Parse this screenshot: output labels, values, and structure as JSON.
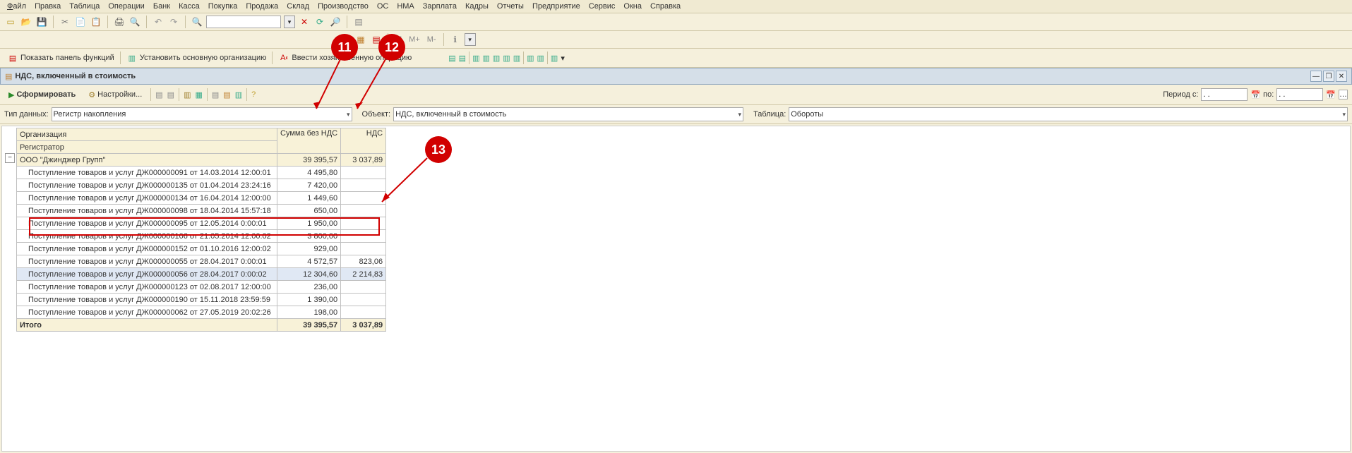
{
  "menu": {
    "file": "Файл",
    "edit": "Правка",
    "table": "Таблица",
    "ops": "Операции",
    "bank": "Банк",
    "cash": "Касса",
    "buy": "Покупка",
    "sell": "Продажа",
    "stock": "Склад",
    "prod": "Производство",
    "os": "ОС",
    "nma": "НМА",
    "salary": "Зарплата",
    "hr": "Кадры",
    "reports": "Отчеты",
    "company": "Предприятие",
    "service": "Сервис",
    "windows": "Окна",
    "help": "Справка"
  },
  "action_bar": {
    "panel": "Показать панель функций",
    "org": "Установить основную организацию",
    "hoz": "Ввести хозяйственную операцию"
  },
  "tab_title": "НДС, включенный в стоимость",
  "report_toolbar": {
    "form": "Сформировать",
    "settings": "Настройки...",
    "period_label": "Период с:",
    "period_to": "по:",
    "period_from_val": ". .",
    "period_to_val": ". ."
  },
  "filters": {
    "type_label": "Тип данных:",
    "type_value": "Регистр накопления",
    "obj_label": "Объект:",
    "obj_value": "НДС, включенный в стоимость",
    "tab_label": "Таблица:",
    "tab_value": "Обороты"
  },
  "headers": {
    "org": "Организация",
    "reg": "Регистратор",
    "sum": "Сумма без НДС",
    "nds": "НДС"
  },
  "group_row": {
    "name": "ООО \"Джинджер Групп\"",
    "sum": "39 395,57",
    "nds": "3 037,89"
  },
  "rows": [
    {
      "reg": "Поступление товаров и услуг ДЖ000000091 от 14.03.2014 12:00:01",
      "sum": "4 495,80",
      "nds": ""
    },
    {
      "reg": "Поступление товаров и услуг ДЖ000000135 от 01.04.2014 23:24:16",
      "sum": "7 420,00",
      "nds": ""
    },
    {
      "reg": "Поступление товаров и услуг ДЖ000000134 от 16.04.2014 12:00:00",
      "sum": "1 449,60",
      "nds": ""
    },
    {
      "reg": "Поступление товаров и услуг ДЖ000000098 от 18.04.2014 15:57:18",
      "sum": "650,00",
      "nds": ""
    },
    {
      "reg": "Поступление товаров и услуг ДЖ000000095 от 12.05.2014 0:00:01",
      "sum": "1 950,00",
      "nds": ""
    },
    {
      "reg": "Поступление товаров и услуг ДЖ000000106 от 21.05.2014 12:00:02",
      "sum": "3 800,00",
      "nds": ""
    },
    {
      "reg": "Поступление товаров и услуг ДЖ000000152 от 01.10.2016 12:00:02",
      "sum": "929,00",
      "nds": ""
    },
    {
      "reg": "Поступление товаров и услуг ДЖ000000055 от 28.04.2017 0:00:01",
      "sum": "4 572,57",
      "nds": "823,06"
    },
    {
      "reg": "Поступление товаров и услуг ДЖ000000056 от 28.04.2017 0:00:02",
      "sum": "12 304,60",
      "nds": "2 214,83",
      "selected": true
    },
    {
      "reg": "Поступление товаров и услуг ДЖ000000123 от 02.08.2017 12:00:00",
      "sum": "236,00",
      "nds": ""
    },
    {
      "reg": "Поступление товаров и услуг ДЖ000000190 от 15.11.2018 23:59:59",
      "sum": "1 390,00",
      "nds": ""
    },
    {
      "reg": "Поступление товаров и услуг ДЖ000000062 от 27.05.2019 20:02:26",
      "sum": "198,00",
      "nds": ""
    }
  ],
  "total": {
    "label": "Итого",
    "sum": "39 395,57",
    "nds": "3 037,89"
  },
  "callouts": {
    "c11": "11",
    "c12": "12",
    "c13": "13"
  },
  "mtext": {
    "m": "М",
    "mplus": "М+",
    "mminus": "М-"
  }
}
